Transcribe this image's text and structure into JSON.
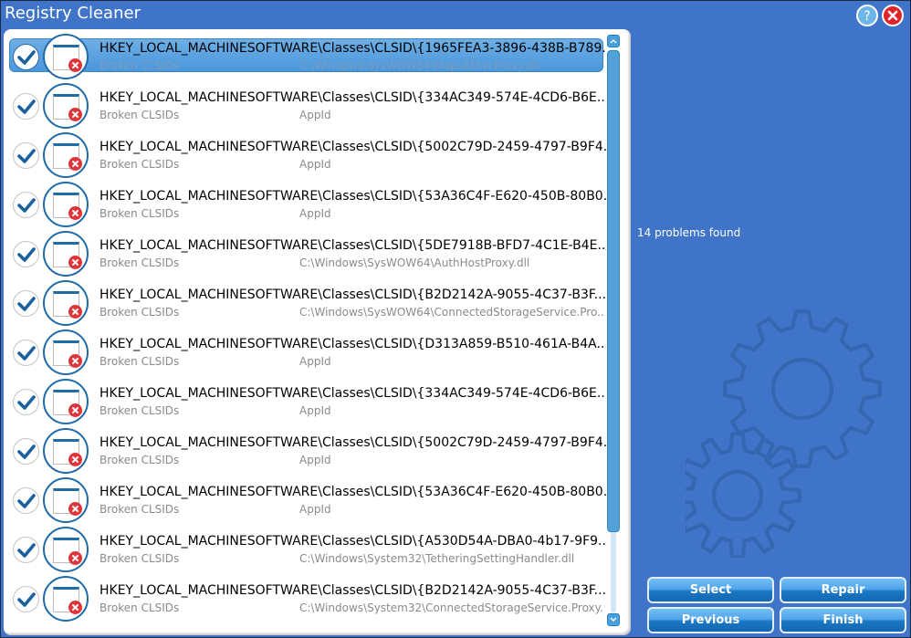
{
  "window": {
    "title": "Registry Cleaner",
    "help_icon": "help-icon",
    "close_icon": "close-icon"
  },
  "status": {
    "text": "14 problems found"
  },
  "list": {
    "selected_index": 0,
    "items": [
      {
        "checked": true,
        "key": "HKEY_LOCAL_MACHINESOFTWARE\\Classes\\CLSID\\{1965FEA3-3896-438B-B789...",
        "category": "Broken CLSIDs",
        "detail": "C:\\Windows\\SysWOW64\\MapsBtSvcProxy.dll"
      },
      {
        "checked": true,
        "key": "HKEY_LOCAL_MACHINESOFTWARE\\Classes\\CLSID\\{334AC349-574E-4CD6-B6E...",
        "category": "Broken CLSIDs",
        "detail": "AppId"
      },
      {
        "checked": true,
        "key": "HKEY_LOCAL_MACHINESOFTWARE\\Classes\\CLSID\\{5002C79D-2459-4797-B9F4...",
        "category": "Broken CLSIDs",
        "detail": "AppId"
      },
      {
        "checked": true,
        "key": "HKEY_LOCAL_MACHINESOFTWARE\\Classes\\CLSID\\{53A36C4F-E620-450B-80B0...",
        "category": "Broken CLSIDs",
        "detail": "AppId"
      },
      {
        "checked": true,
        "key": "HKEY_LOCAL_MACHINESOFTWARE\\Classes\\CLSID\\{5DE7918B-BFD7-4C1E-B4E...",
        "category": "Broken CLSIDs",
        "detail": "C:\\Windows\\SysWOW64\\AuthHostProxy.dll"
      },
      {
        "checked": true,
        "key": "HKEY_LOCAL_MACHINESOFTWARE\\Classes\\CLSID\\{B2D2142A-9055-4C37-B3F...",
        "category": "Broken CLSIDs",
        "detail": "C:\\Windows\\SysWOW64\\ConnectedStorageService.Pro..."
      },
      {
        "checked": true,
        "key": "HKEY_LOCAL_MACHINESOFTWARE\\Classes\\CLSID\\{D313A859-B510-461A-B4A...",
        "category": "Broken CLSIDs",
        "detail": "AppId"
      },
      {
        "checked": true,
        "key": "HKEY_LOCAL_MACHINESOFTWARE\\Classes\\CLSID\\{334AC349-574E-4CD6-B6E...",
        "category": "Broken CLSIDs",
        "detail": "AppId"
      },
      {
        "checked": true,
        "key": "HKEY_LOCAL_MACHINESOFTWARE\\Classes\\CLSID\\{5002C79D-2459-4797-B9F4...",
        "category": "Broken CLSIDs",
        "detail": "AppId"
      },
      {
        "checked": true,
        "key": "HKEY_LOCAL_MACHINESOFTWARE\\Classes\\CLSID\\{53A36C4F-E620-450B-80B0...",
        "category": "Broken CLSIDs",
        "detail": "AppId"
      },
      {
        "checked": true,
        "key": "HKEY_LOCAL_MACHINESOFTWARE\\Classes\\CLSID\\{A530D54A-DBA0-4b17-9F9...",
        "category": "Broken CLSIDs",
        "detail": "C:\\Windows\\System32\\TetheringSettingHandler.dll"
      },
      {
        "checked": true,
        "key": "HKEY_LOCAL_MACHINESOFTWARE\\Classes\\CLSID\\{B2D2142A-9055-4C37-B3F...",
        "category": "Broken CLSIDs",
        "detail": "C:\\Windows\\System32\\ConnectedStorageService.Proxy..."
      }
    ]
  },
  "buttons": {
    "select": "Select",
    "repair": "Repair",
    "previous": "Previous",
    "finish": "Finish"
  },
  "colors": {
    "background": "#4074c8",
    "accent": "#1f6aa8",
    "selected_row": "#5aa2e0",
    "error": "#e0363a"
  }
}
